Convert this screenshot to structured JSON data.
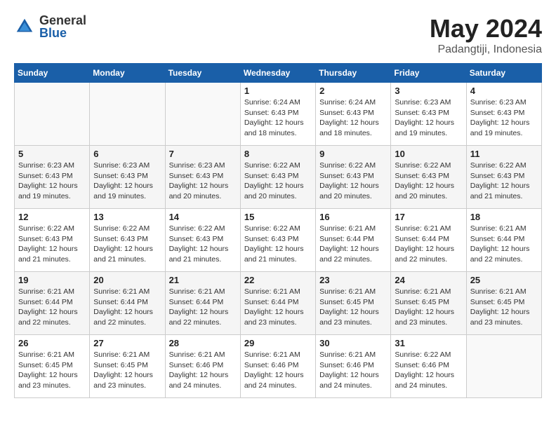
{
  "header": {
    "logo_general": "General",
    "logo_blue": "Blue",
    "month_title": "May 2024",
    "location": "Padangtiji, Indonesia"
  },
  "days_of_week": [
    "Sunday",
    "Monday",
    "Tuesday",
    "Wednesday",
    "Thursday",
    "Friday",
    "Saturday"
  ],
  "weeks": [
    [
      {
        "day": "",
        "info": ""
      },
      {
        "day": "",
        "info": ""
      },
      {
        "day": "",
        "info": ""
      },
      {
        "day": "1",
        "info": "Sunrise: 6:24 AM\nSunset: 6:43 PM\nDaylight: 12 hours\nand 18 minutes."
      },
      {
        "day": "2",
        "info": "Sunrise: 6:24 AM\nSunset: 6:43 PM\nDaylight: 12 hours\nand 18 minutes."
      },
      {
        "day": "3",
        "info": "Sunrise: 6:23 AM\nSunset: 6:43 PM\nDaylight: 12 hours\nand 19 minutes."
      },
      {
        "day": "4",
        "info": "Sunrise: 6:23 AM\nSunset: 6:43 PM\nDaylight: 12 hours\nand 19 minutes."
      }
    ],
    [
      {
        "day": "5",
        "info": "Sunrise: 6:23 AM\nSunset: 6:43 PM\nDaylight: 12 hours\nand 19 minutes."
      },
      {
        "day": "6",
        "info": "Sunrise: 6:23 AM\nSunset: 6:43 PM\nDaylight: 12 hours\nand 19 minutes."
      },
      {
        "day": "7",
        "info": "Sunrise: 6:23 AM\nSunset: 6:43 PM\nDaylight: 12 hours\nand 20 minutes."
      },
      {
        "day": "8",
        "info": "Sunrise: 6:22 AM\nSunset: 6:43 PM\nDaylight: 12 hours\nand 20 minutes."
      },
      {
        "day": "9",
        "info": "Sunrise: 6:22 AM\nSunset: 6:43 PM\nDaylight: 12 hours\nand 20 minutes."
      },
      {
        "day": "10",
        "info": "Sunrise: 6:22 AM\nSunset: 6:43 PM\nDaylight: 12 hours\nand 20 minutes."
      },
      {
        "day": "11",
        "info": "Sunrise: 6:22 AM\nSunset: 6:43 PM\nDaylight: 12 hours\nand 21 minutes."
      }
    ],
    [
      {
        "day": "12",
        "info": "Sunrise: 6:22 AM\nSunset: 6:43 PM\nDaylight: 12 hours\nand 21 minutes."
      },
      {
        "day": "13",
        "info": "Sunrise: 6:22 AM\nSunset: 6:43 PM\nDaylight: 12 hours\nand 21 minutes."
      },
      {
        "day": "14",
        "info": "Sunrise: 6:22 AM\nSunset: 6:43 PM\nDaylight: 12 hours\nand 21 minutes."
      },
      {
        "day": "15",
        "info": "Sunrise: 6:22 AM\nSunset: 6:43 PM\nDaylight: 12 hours\nand 21 minutes."
      },
      {
        "day": "16",
        "info": "Sunrise: 6:21 AM\nSunset: 6:44 PM\nDaylight: 12 hours\nand 22 minutes."
      },
      {
        "day": "17",
        "info": "Sunrise: 6:21 AM\nSunset: 6:44 PM\nDaylight: 12 hours\nand 22 minutes."
      },
      {
        "day": "18",
        "info": "Sunrise: 6:21 AM\nSunset: 6:44 PM\nDaylight: 12 hours\nand 22 minutes."
      }
    ],
    [
      {
        "day": "19",
        "info": "Sunrise: 6:21 AM\nSunset: 6:44 PM\nDaylight: 12 hours\nand 22 minutes."
      },
      {
        "day": "20",
        "info": "Sunrise: 6:21 AM\nSunset: 6:44 PM\nDaylight: 12 hours\nand 22 minutes."
      },
      {
        "day": "21",
        "info": "Sunrise: 6:21 AM\nSunset: 6:44 PM\nDaylight: 12 hours\nand 22 minutes."
      },
      {
        "day": "22",
        "info": "Sunrise: 6:21 AM\nSunset: 6:44 PM\nDaylight: 12 hours\nand 23 minutes."
      },
      {
        "day": "23",
        "info": "Sunrise: 6:21 AM\nSunset: 6:45 PM\nDaylight: 12 hours\nand 23 minutes."
      },
      {
        "day": "24",
        "info": "Sunrise: 6:21 AM\nSunset: 6:45 PM\nDaylight: 12 hours\nand 23 minutes."
      },
      {
        "day": "25",
        "info": "Sunrise: 6:21 AM\nSunset: 6:45 PM\nDaylight: 12 hours\nand 23 minutes."
      }
    ],
    [
      {
        "day": "26",
        "info": "Sunrise: 6:21 AM\nSunset: 6:45 PM\nDaylight: 12 hours\nand 23 minutes."
      },
      {
        "day": "27",
        "info": "Sunrise: 6:21 AM\nSunset: 6:45 PM\nDaylight: 12 hours\nand 23 minutes."
      },
      {
        "day": "28",
        "info": "Sunrise: 6:21 AM\nSunset: 6:46 PM\nDaylight: 12 hours\nand 24 minutes."
      },
      {
        "day": "29",
        "info": "Sunrise: 6:21 AM\nSunset: 6:46 PM\nDaylight: 12 hours\nand 24 minutes."
      },
      {
        "day": "30",
        "info": "Sunrise: 6:21 AM\nSunset: 6:46 PM\nDaylight: 12 hours\nand 24 minutes."
      },
      {
        "day": "31",
        "info": "Sunrise: 6:22 AM\nSunset: 6:46 PM\nDaylight: 12 hours\nand 24 minutes."
      },
      {
        "day": "",
        "info": ""
      }
    ]
  ]
}
